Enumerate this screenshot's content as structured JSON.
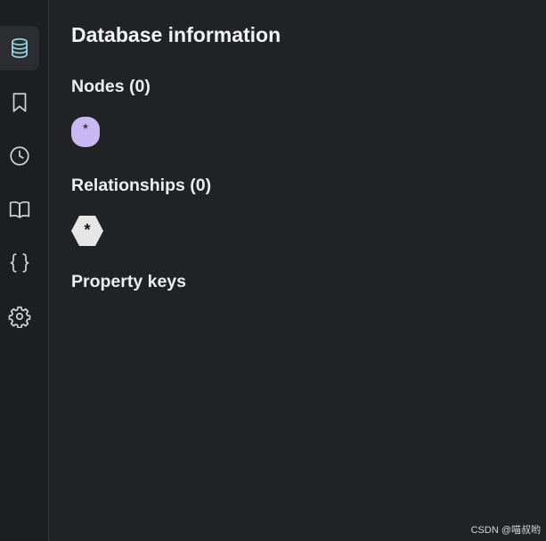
{
  "sidebar": {
    "items": [
      {
        "icon": "database-icon",
        "active": true
      },
      {
        "icon": "bookmark-icon",
        "active": false
      },
      {
        "icon": "history-clock-icon",
        "active": false
      },
      {
        "icon": "book-open-icon",
        "active": false
      },
      {
        "icon": "curly-braces-icon",
        "active": false
      },
      {
        "icon": "gear-icon",
        "active": false
      }
    ]
  },
  "main": {
    "title": "Database information",
    "nodes_heading": "Nodes (0)",
    "node_label": "*",
    "relationships_heading": "Relationships (0)",
    "relationship_label": "*",
    "property_keys_heading": "Property keys"
  },
  "watermark": "CSDN @喵叔哟",
  "colors": {
    "background": "#212226",
    "sidebar": "#1d1e21",
    "active_icon": "#8fd3e0",
    "icon": "#cfd2d6",
    "node_pill": "#c9b6f3",
    "relationship_hex": "#e6e6e6"
  }
}
